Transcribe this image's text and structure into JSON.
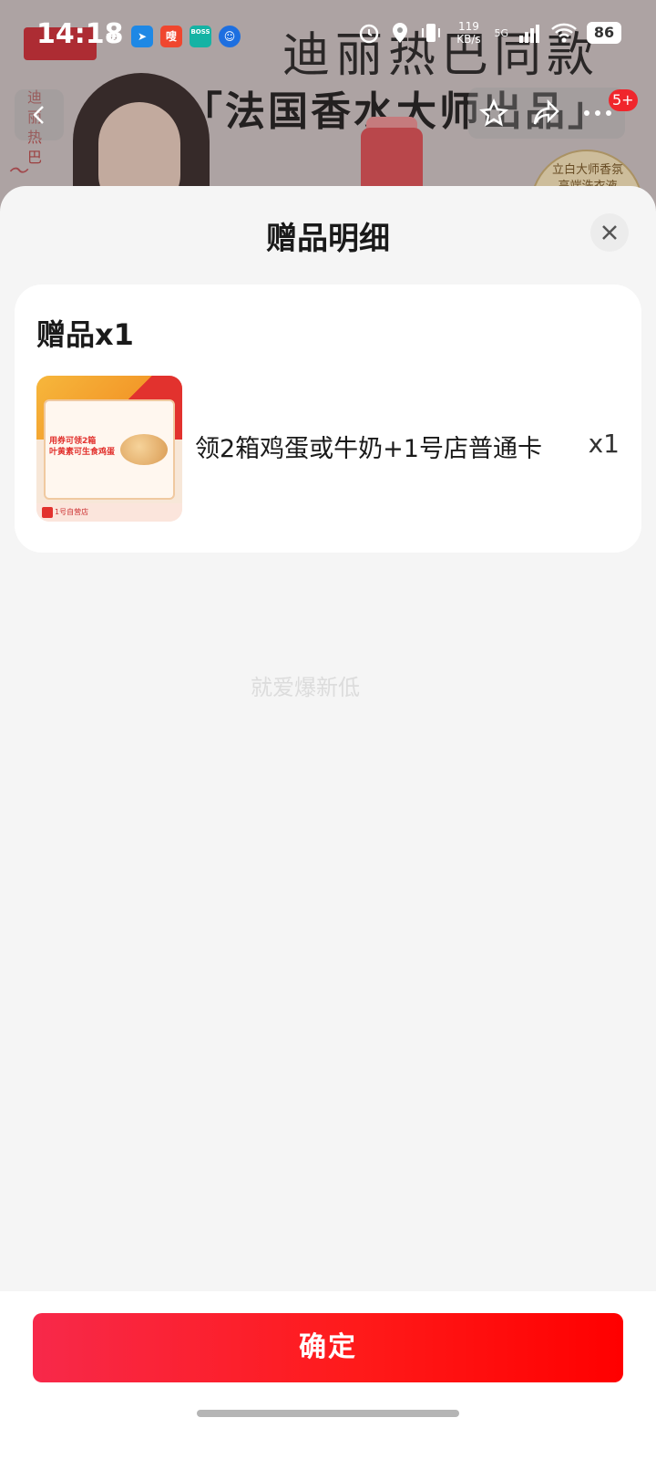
{
  "status_bar": {
    "time": "14:18",
    "apps": [
      "嗖",
      "BOSS 直聘"
    ],
    "net_speed": "119 KB/s",
    "network": "5G",
    "battery": "86"
  },
  "banner": {
    "headline": "迪丽热巴同款",
    "subline": "「法国香水大师出品」",
    "side_text": "迪丽热巴",
    "seal_text": "立白大师香氛 高端洗衣液",
    "nav_badge": "5+"
  },
  "sheet": {
    "title": "赠品明细",
    "section_header": "赠品x1",
    "gift": {
      "name": "领2箱鸡蛋或牛奶+1号店普通卡",
      "qty": "x1",
      "thumb_line1": "用券可领2箱",
      "thumb_line2": "叶黄素可生食鸡蛋",
      "thumb_footer": "1号自营店"
    },
    "watermark": "就爱爆新低"
  },
  "footer": {
    "confirm_label": "确定"
  }
}
